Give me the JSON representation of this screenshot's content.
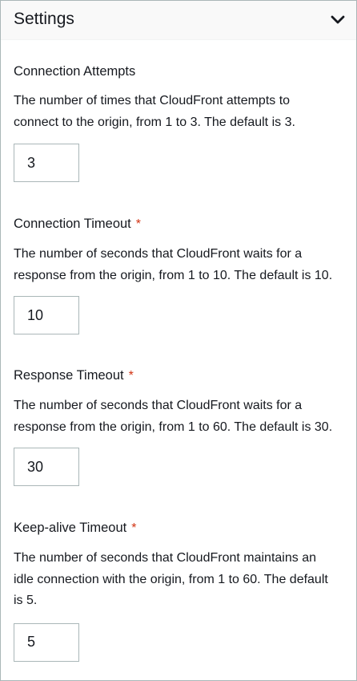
{
  "header": {
    "title": "Settings",
    "toggle_icon": "chevron-down-icon"
  },
  "fields": [
    {
      "label": "Connection Attempts",
      "required": false,
      "description_lines": [
        "The number of times that CloudFront attempts to",
        "connect to the origin, from 1 to 3. The default is 3."
      ],
      "value": "3"
    },
    {
      "label": "Connection Timeout",
      "required": true,
      "required_marker": "*",
      "description_lines": [
        "The number of seconds that CloudFront waits for a",
        "response from the origin, from 1 to 10. The default is 10."
      ],
      "value": "10"
    },
    {
      "label": "Response Timeout",
      "required": true,
      "required_marker": "*",
      "description_lines": [
        "The number of seconds that CloudFront waits for a",
        "response from the origin, from 1 to 60. The default is 30."
      ],
      "value": "30"
    },
    {
      "label": "Keep-alive Timeout",
      "required": true,
      "required_marker": "*",
      "description_lines": [
        "The number of seconds that CloudFront maintains an",
        "idle connection with the origin, from 1 to 60. The default",
        "is 5."
      ],
      "value": "5"
    }
  ],
  "colors": {
    "required": "#d13212",
    "border": "#aab7b8",
    "header_bg": "#f9f9f9",
    "text": "#16191f"
  }
}
